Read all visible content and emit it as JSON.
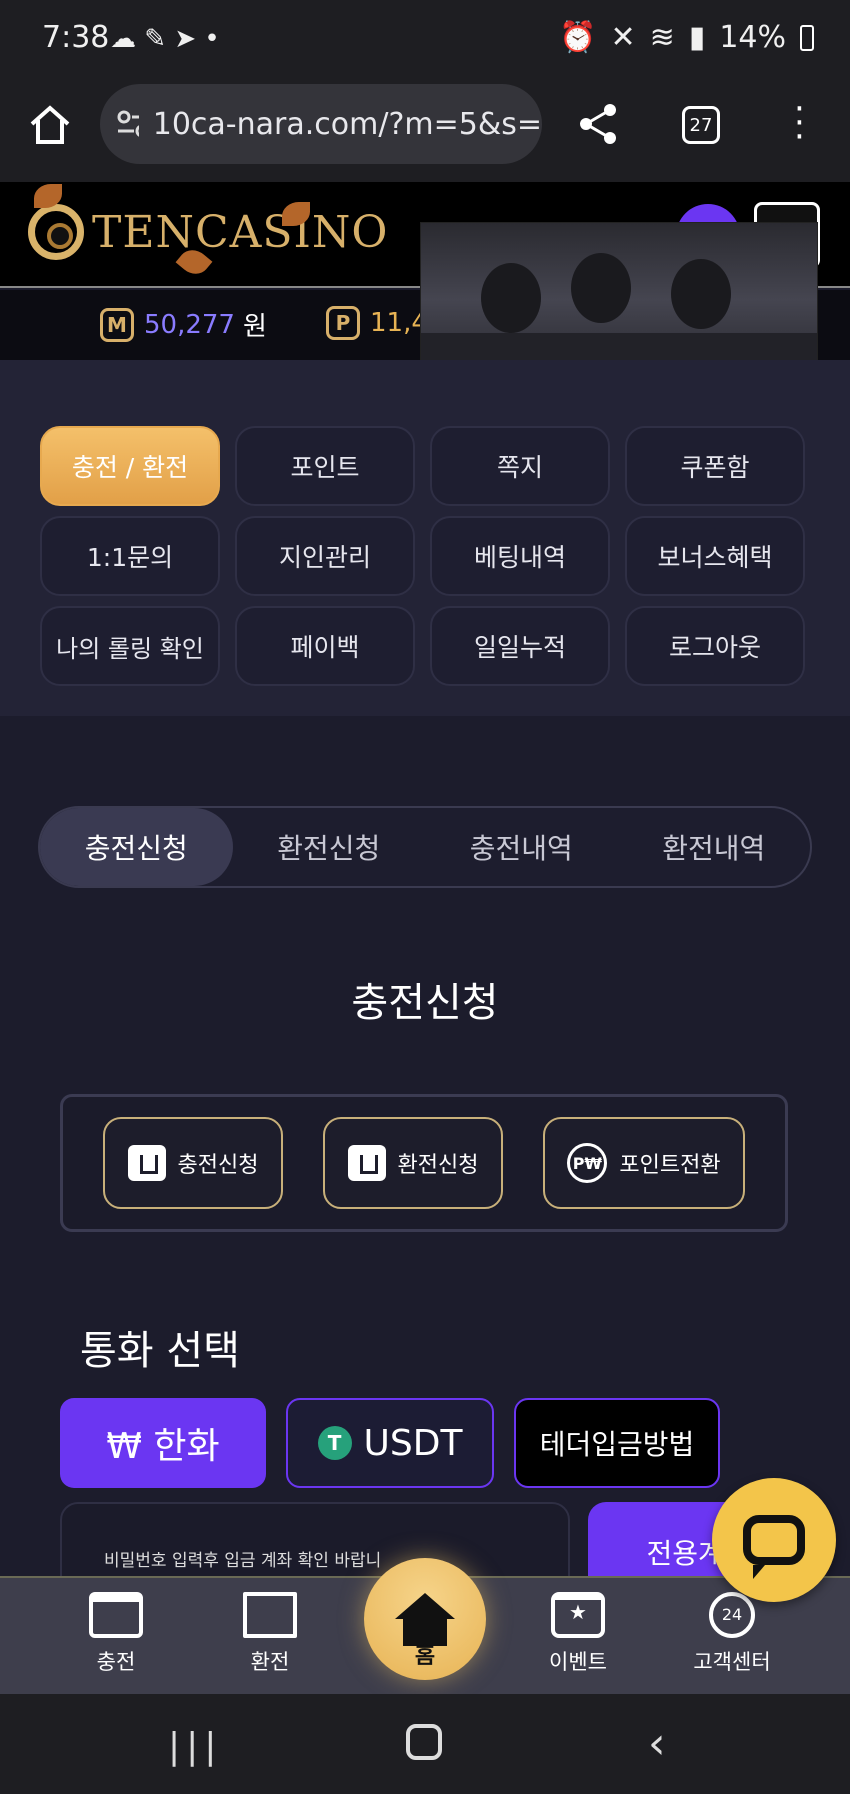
{
  "status_bar": {
    "time": "7:38",
    "battery": "14%"
  },
  "browser": {
    "url": "10ca-nara.com/?m=5&s=",
    "tab_count": "27"
  },
  "site": {
    "logo_text": "TenCasino"
  },
  "balances": {
    "money_icon": "M",
    "money_value": "50,277",
    "money_unit": "원",
    "point_icon": "P",
    "point_value": "11,4"
  },
  "menu": [
    {
      "label": "충전 / 환전",
      "active": true
    },
    {
      "label": "포인트"
    },
    {
      "label": "쪽지"
    },
    {
      "label": "쿠폰함"
    },
    {
      "label": "1:1문의"
    },
    {
      "label": "지인관리"
    },
    {
      "label": "베팅내역"
    },
    {
      "label": "보너스혜택"
    },
    {
      "label": "나의 롤링 확인"
    },
    {
      "label": "페이백"
    },
    {
      "label": "일일누적"
    },
    {
      "label": "로그아웃"
    }
  ],
  "tabs": [
    {
      "label": "충전신청",
      "active": true
    },
    {
      "label": "환전신청"
    },
    {
      "label": "충전내역"
    },
    {
      "label": "환전내역"
    }
  ],
  "section_title": "충전신청",
  "actions": [
    {
      "label": "충전신청",
      "icon": "deposit-icon"
    },
    {
      "label": "환전신청",
      "icon": "withdraw-icon"
    },
    {
      "label": "포인트전환",
      "icon": "point-exchange-icon",
      "icon_text": "P₩"
    }
  ],
  "currency": {
    "title": "통화 선택",
    "options": [
      {
        "label": "₩ 한화",
        "active": true
      },
      {
        "label": "USDT"
      },
      {
        "label": "테더입금방법"
      }
    ]
  },
  "notice_text": "비밀번호 입력후 입금 계좌 확인 바랍니",
  "dedicated_button": "전용계좌",
  "bottom_nav": [
    {
      "label": "충전",
      "icon": "card-icon"
    },
    {
      "label": "환전",
      "icon": "atm-icon"
    },
    {
      "label": "홈",
      "icon": "home-icon"
    },
    {
      "label": "이벤트",
      "icon": "calendar-star-icon"
    },
    {
      "label": "고객센터",
      "icon": "support-24-icon"
    }
  ],
  "colors": {
    "accent": "#6b36f2",
    "gold": "#e7b354",
    "background": "#1c1c2c"
  }
}
